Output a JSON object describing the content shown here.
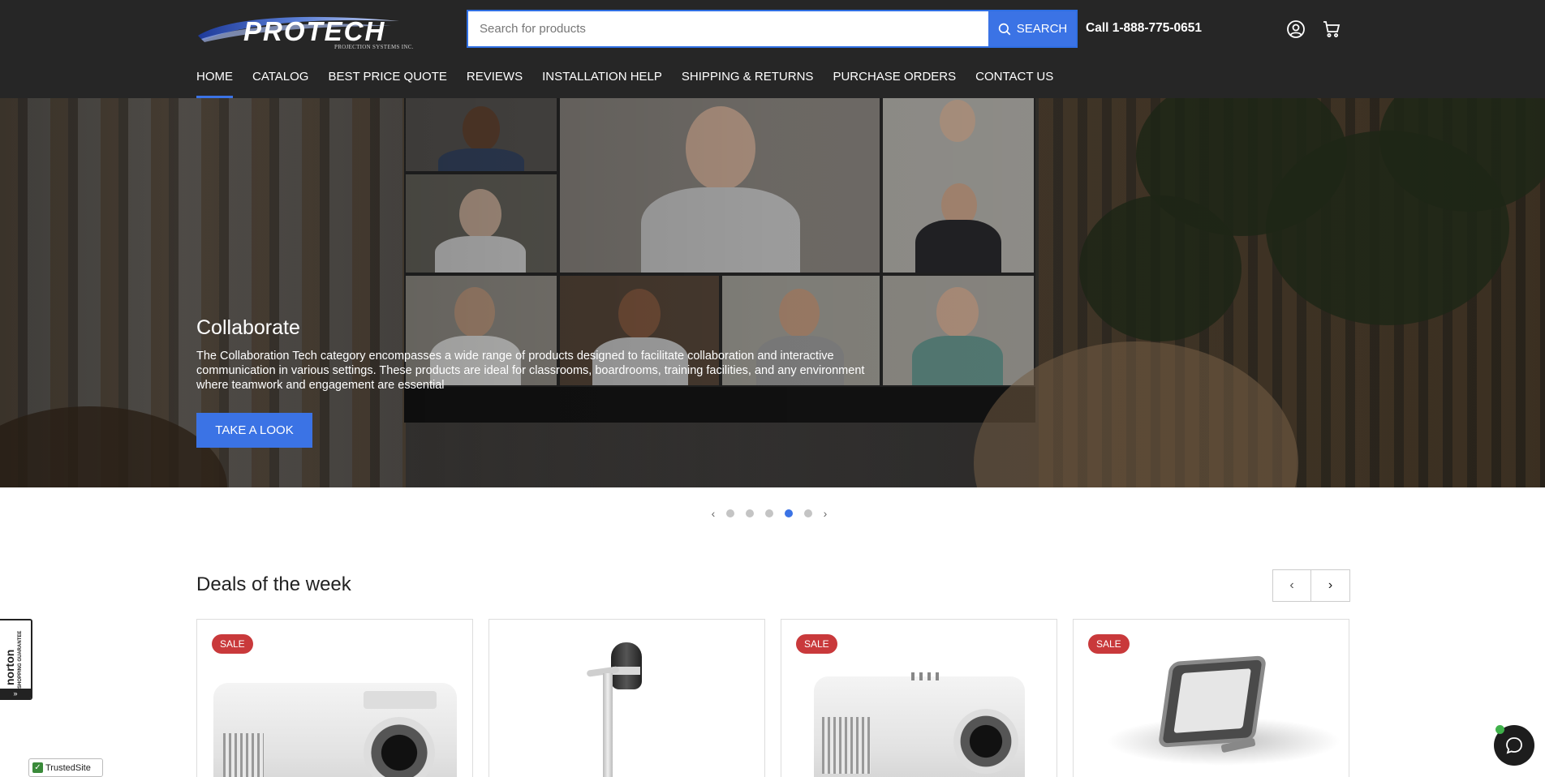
{
  "header": {
    "logo_text": "PROTECH",
    "logo_subtext": "PROJECTION SYSTEMS INC.",
    "search_placeholder": "Search for products",
    "search_button": "SEARCH",
    "phone": "Call 1-888-775-0651",
    "account_icon": "user-circle-icon",
    "cart_icon": "cart-icon"
  },
  "nav": [
    {
      "label": "HOME",
      "active": true
    },
    {
      "label": "CATALOG"
    },
    {
      "label": "BEST PRICE QUOTE"
    },
    {
      "label": "REVIEWS"
    },
    {
      "label": "INSTALLATION HELP"
    },
    {
      "label": "SHIPPING & RETURNS"
    },
    {
      "label": "PURCHASE ORDERS"
    },
    {
      "label": "CONTACT US"
    }
  ],
  "hero": {
    "title": "Collaborate",
    "description": "The Collaboration Tech category encompasses a wide range of products designed to facilitate collaboration and interactive communication in various settings. These products are ideal for classrooms, boardrooms, training facilities, and any environment where teamwork and engagement are essential",
    "cta": "TAKE A LOOK",
    "slide_count": 5,
    "active_slide": 4
  },
  "deals": {
    "title": "Deals of the week",
    "products": [
      {
        "badge": "SALE",
        "image": "projector-image"
      },
      {
        "badge": "",
        "image": "document-camera-image"
      },
      {
        "badge": "SALE",
        "image": "projector-image"
      },
      {
        "badge": "SALE",
        "image": "touch-panel-image"
      }
    ]
  },
  "badges": {
    "norton": "norton",
    "norton_sub": "SHOPPING GUARANTEE",
    "trusted": "TrustedSite"
  },
  "colors": {
    "accent": "#3b73e5",
    "header_bg": "#262626",
    "sale": "#c9393b"
  }
}
